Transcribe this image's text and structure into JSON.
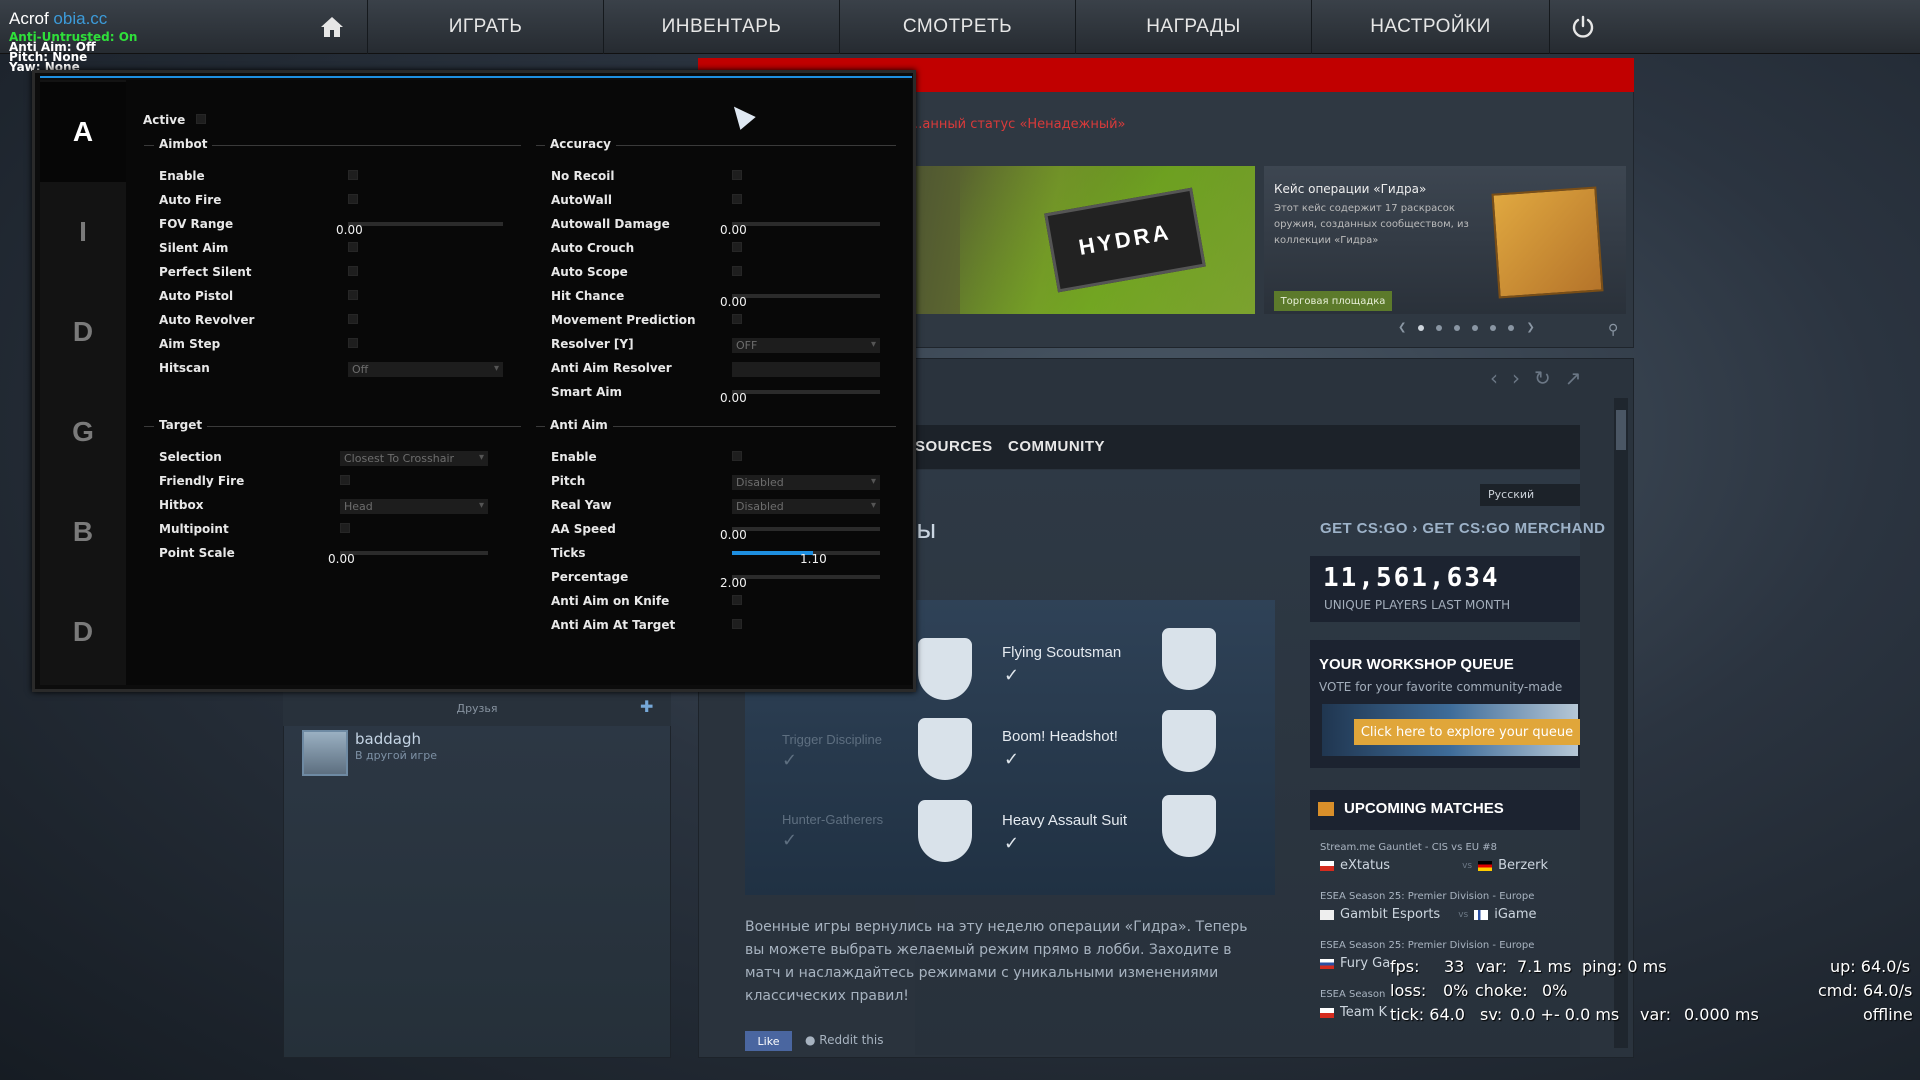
{
  "overlay": {
    "title_main": "Acrof",
    "title_domain": "obia.cc",
    "anti_untrusted": "Anti-Untrusted: On",
    "anti_aim": "Anti Aim: Off",
    "pitch": "Pitch: None",
    "yaw": "Yaw: None",
    "anti_untrusted_color": "#2fe03a"
  },
  "nav": {
    "items": [
      "ИГРАТЬ",
      "ИНВЕНТАРЬ",
      "СМОТРЕТЬ",
      "НАГРАДЫ",
      "НАСТРОЙКИ"
    ],
    "home_icon": "home-icon",
    "power_icon": "power-icon"
  },
  "news": {
    "status_text": "...анный статус «Ненадежный»",
    "hydra_label": "HYDRA",
    "case_title": "Кейс операции «Гидра»",
    "case_desc": "Этот кейс содержит 17 раскрасок оружия, созданных сообществом, из коллекции «Гидра»",
    "market_button": "Торговая площадка"
  },
  "web": {
    "nav_items": [
      "SOURCES",
      "COMMUNITY"
    ],
    "language": "Русский",
    "heading_fragment": "ы",
    "get_csgo": "GET CS:GO",
    "get_merch": "GET CS:GO MERCHAND",
    "players_count": "11,561,634",
    "players_caption": "UNIQUE PLAYERS LAST MONTH",
    "workshop_title": "YOUR WORKSHOP QUEUE",
    "workshop_sub": "VOTE for your favorite community-made",
    "workshop_cta": "Click here to explore your queue",
    "upcoming_title": "UPCOMING MATCHES",
    "matches": [
      {
        "event": "Stream.me Gauntlet - CIS vs EU #8",
        "team1": "eXtatus",
        "team2": "Berzerk"
      },
      {
        "event": "ESEA Season 25: Premier Division - Europe",
        "team1": "Gambit Esports",
        "team2": "iGame"
      },
      {
        "event": "ESEA Season 25: Premier Division - Europe",
        "team1": "Fury Ga",
        "team2": ""
      },
      {
        "event": "ESEA Season",
        "team1": "Team K",
        "team2": ""
      }
    ],
    "vs": "vs",
    "achievements": {
      "left": [
        "",
        "Trigger Discipline",
        "Hunter-Gatherers"
      ],
      "right": [
        "Flying Scoutsman",
        "Boom! Headshot!",
        "Heavy Assault Suit"
      ]
    },
    "news_text": "Военные игры вернулись на эту неделю операции «Гидра». Теперь вы можете выбрать желаемый режим прямо в лобби. Заходите в матч и наслаждайтесь режимами с уникальными изменениями классических правил!",
    "like": "Like",
    "reddit": "Reddit this"
  },
  "friends": {
    "header": "Друзья",
    "name": "baddagh",
    "status": "В другой игре"
  },
  "netgraph": {
    "fps": "fps:",
    "fps_val": "33",
    "var": "var:",
    "var_val": "7.1 ms",
    "ping": "ping: 0 ms",
    "loss": "loss:",
    "loss_val": "0%",
    "choke": "choke:",
    "choke_val": "0%",
    "tick": "tick: 64.0",
    "sv": "sv:",
    "sv_val": "0.0 +- 0.0 ms",
    "var2": "var:",
    "var2_val": "0.000 ms",
    "up": "up: 64.0/s",
    "cmd": "cmd: 64.0/s",
    "offline": "offline"
  },
  "menu": {
    "tabs": [
      "A",
      "I",
      "D",
      "G",
      "B",
      "D"
    ],
    "active_label": "Active",
    "aimbot": {
      "title": "Aimbot",
      "rows": [
        "Enable",
        "Auto Fire",
        "FOV Range",
        "Silent Aim",
        "Perfect Silent",
        "Auto Pistol",
        "Auto Revolver",
        "Aim Step",
        "Hitscan"
      ],
      "fov_value": "0.00",
      "hitscan_value": "Off"
    },
    "target": {
      "title": "Target",
      "rows": [
        "Selection",
        "Friendly Fire",
        "Hitbox",
        "Multipoint",
        "Point Scale"
      ],
      "selection_value": "Closest To Crosshair",
      "hitbox_value": "Head",
      "point_scale_value": "0.00"
    },
    "accuracy": {
      "title": "Accuracy",
      "rows": [
        "No Recoil",
        "AutoWall",
        "Autowall Damage",
        "Auto Crouch",
        "Auto Scope",
        "Hit Chance",
        "Movement Prediction",
        "Resolver [Y]",
        "Anti Aim Resolver",
        "Smart Aim"
      ],
      "autowall_damage_value": "0.00",
      "hit_chance_value": "0.00",
      "resolver_value": "OFF",
      "smart_aim_value": "0.00"
    },
    "antiaim": {
      "title": "Anti Aim",
      "rows": [
        "Enable",
        "Pitch",
        "Real Yaw",
        "AA Speed",
        "Ticks",
        "Percentage",
        "Anti Aim on Knife",
        "Anti Aim At Target"
      ],
      "pitch_value": "Disabled",
      "real_yaw_value": "Disabled",
      "aa_speed_value": "0.00",
      "ticks_value": "1.10",
      "ticks_fraction": 0.55,
      "percentage_value": "2.00"
    },
    "accent_color": "#1e8fe0"
  }
}
